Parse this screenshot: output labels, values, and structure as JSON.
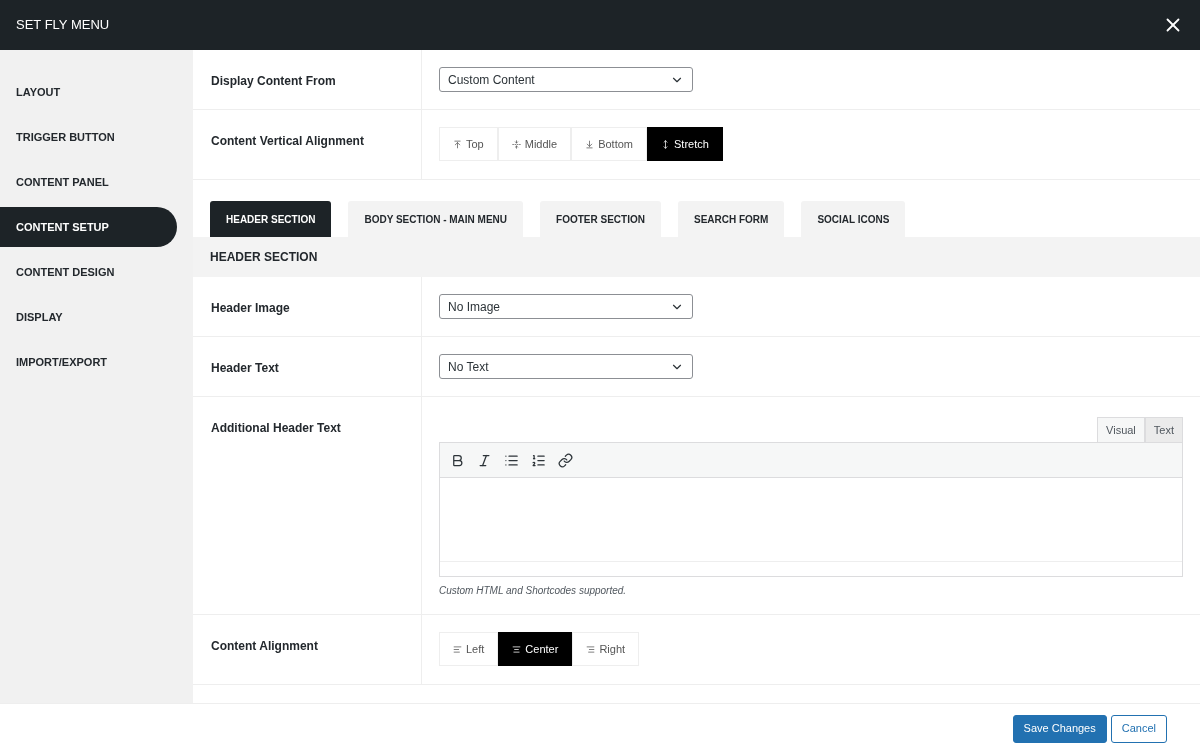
{
  "window": {
    "title": "SET FLY MENU"
  },
  "sidebar": {
    "items": [
      {
        "label": "LAYOUT",
        "selected": false
      },
      {
        "label": "TRIGGER BUTTON",
        "selected": false
      },
      {
        "label": "CONTENT PANEL",
        "selected": false
      },
      {
        "label": "CONTENT SETUP",
        "selected": true
      },
      {
        "label": "CONTENT DESIGN",
        "selected": false
      },
      {
        "label": "DISPLAY",
        "selected": false
      },
      {
        "label": "IMPORT/EXPORT",
        "selected": false
      }
    ]
  },
  "top_fields": [
    {
      "kind": "select",
      "label": "Display Content From",
      "value": "Custom Content"
    },
    {
      "kind": "segmented",
      "label": "Content Vertical Alignment",
      "options": [
        {
          "label": "Top",
          "kind": "top",
          "selected": false
        },
        {
          "label": "Middle",
          "kind": "middle",
          "selected": false
        },
        {
          "label": "Bottom",
          "kind": "bottom",
          "selected": false
        },
        {
          "label": "Stretch",
          "kind": "stretch",
          "selected": true
        }
      ]
    }
  ],
  "tabs": [
    {
      "label": "HEADER SECTION",
      "selected": true
    },
    {
      "label": "BODY SECTION - MAIN MENU",
      "selected": false
    },
    {
      "label": "FOOTER SECTION",
      "selected": false
    },
    {
      "label": "SEARCH FORM",
      "selected": false
    },
    {
      "label": "SOCIAL ICONS",
      "selected": false
    }
  ],
  "section": {
    "title": "HEADER SECTION",
    "fields": [
      {
        "kind": "select",
        "label": "Header Image",
        "value": "No Image"
      },
      {
        "kind": "select",
        "label": "Header Text",
        "value": "No Text"
      },
      {
        "kind": "editor",
        "label": "Additional Header Text",
        "modes": [
          {
            "label": "Visual",
            "selected": true
          },
          {
            "label": "Text",
            "selected": false
          }
        ],
        "note": "Custom HTML and Shortcodes supported."
      },
      {
        "kind": "segmented",
        "label": "Content Alignment",
        "options": [
          {
            "label": "Left",
            "kind": "left",
            "selected": false
          },
          {
            "label": "Center",
            "kind": "center",
            "selected": true
          },
          {
            "label": "Right",
            "kind": "right",
            "selected": false
          }
        ]
      }
    ]
  },
  "footer": {
    "buttons": [
      {
        "label": "Save Changes",
        "kind": "primary"
      },
      {
        "label": "Cancel",
        "kind": "secondary"
      }
    ]
  }
}
